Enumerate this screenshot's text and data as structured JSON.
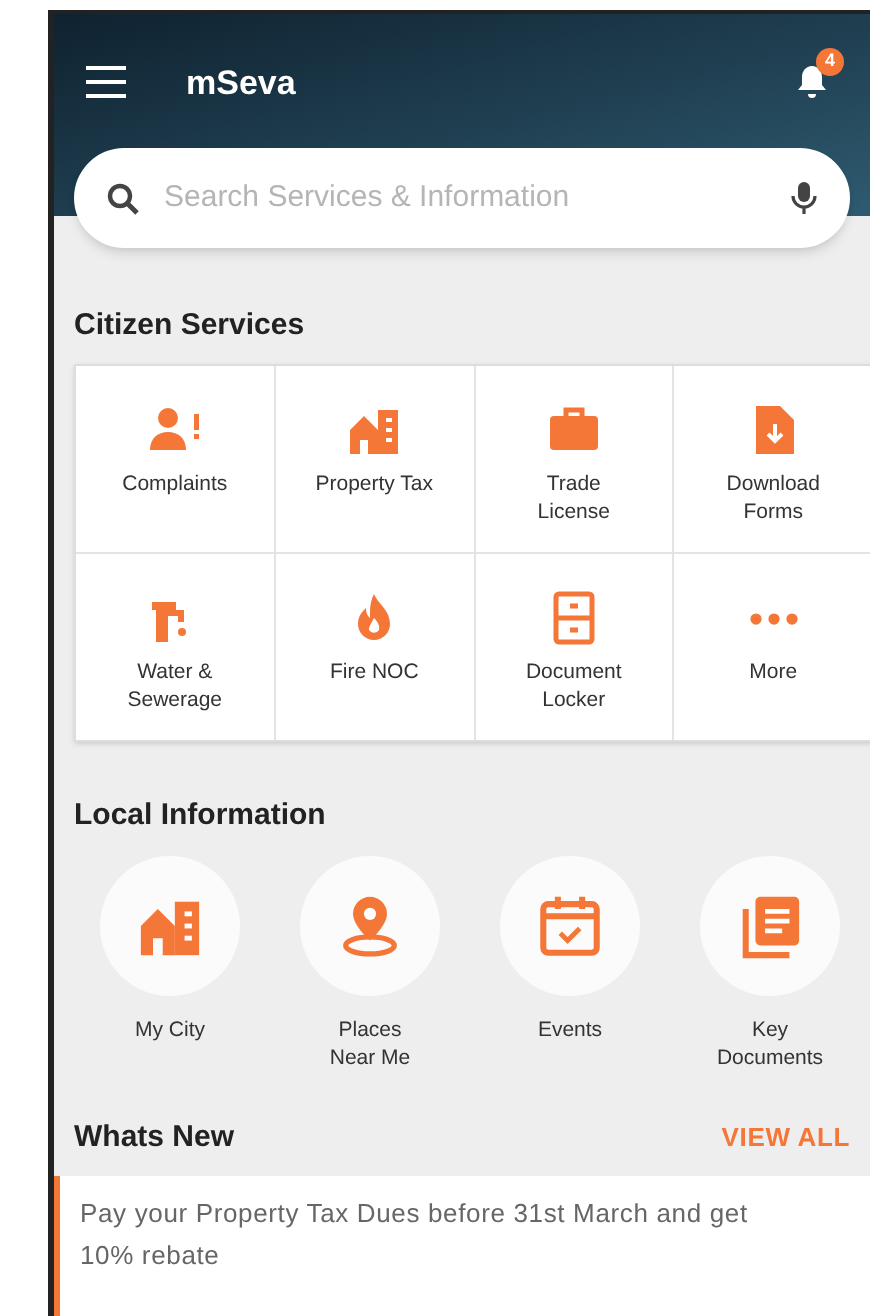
{
  "app_bar": {
    "title": "mSeva",
    "notification_count": "4"
  },
  "search": {
    "placeholder": "Search Services & Information"
  },
  "citizen_services": {
    "heading": "Citizen Services",
    "items": [
      {
        "label": "Complaints"
      },
      {
        "label": "Property Tax"
      },
      {
        "label": "Trade License"
      },
      {
        "label": "Download Forms"
      },
      {
        "label": "Water & Sewerage"
      },
      {
        "label": "Fire NOC"
      },
      {
        "label": "Document Locker"
      },
      {
        "label": "More"
      }
    ]
  },
  "local_information": {
    "heading": "Local Information",
    "items": [
      {
        "label": "My City"
      },
      {
        "label": "Places Near Me"
      },
      {
        "label": "Events"
      },
      {
        "label": "Key Documents"
      }
    ]
  },
  "whats_new": {
    "heading": "Whats New",
    "view_all": "VIEW ALL",
    "items": [
      {
        "text": "Pay your Property Tax Dues before 31st March and get 10% rebate"
      }
    ]
  }
}
